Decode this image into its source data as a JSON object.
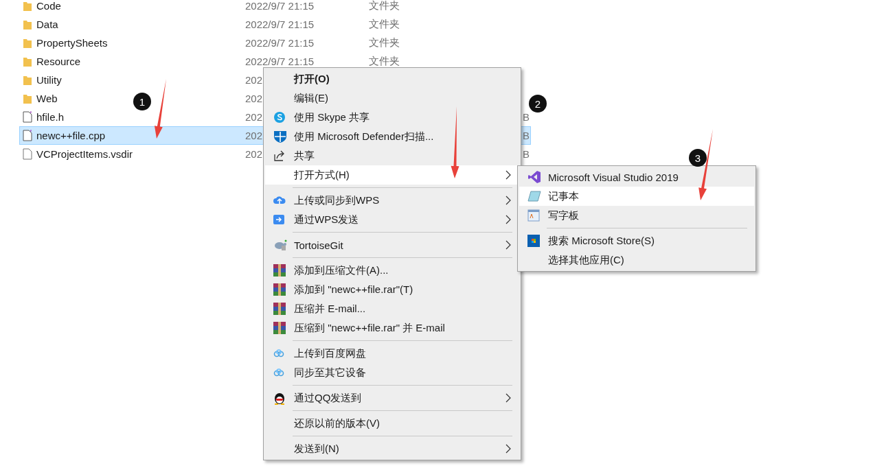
{
  "files": [
    {
      "name": "Code",
      "date": "2022/9/7 21:15",
      "type": "文件夹",
      "kind": "folder",
      "selected": false
    },
    {
      "name": "Data",
      "date": "2022/9/7 21:15",
      "type": "文件夹",
      "kind": "folder",
      "selected": false
    },
    {
      "name": "PropertySheets",
      "date": "2022/9/7 21:15",
      "type": "文件夹",
      "kind": "folder",
      "selected": false
    },
    {
      "name": "Resource",
      "date": "2022/9/7 21:15",
      "type": "文件夹",
      "kind": "folder",
      "selected": false
    },
    {
      "name": "Utility",
      "date": "202",
      "kind": "folder",
      "selected": false
    },
    {
      "name": "Web",
      "date": "202",
      "kind": "folder",
      "selected": false
    },
    {
      "name": "hfile.h",
      "date": "202",
      "size": "B",
      "kind": "code",
      "selected": false
    },
    {
      "name": "newc++file.cpp",
      "date": "202",
      "size": "B",
      "kind": "code",
      "selected": true
    },
    {
      "name": "VCProjectItems.vsdir",
      "date": "202",
      "size": "B",
      "kind": "file",
      "selected": false
    }
  ],
  "context_menu": {
    "sections": [
      [
        {
          "label": "打开(O)",
          "default": true,
          "selected": false,
          "submenu": false
        },
        {
          "label": "编辑(E)",
          "default": false,
          "selected": false,
          "submenu": false
        },
        {
          "label": "使用 Skype 共享",
          "default": false,
          "selected": false,
          "submenu": false
        },
        {
          "label": "使用 Microsoft Defender扫描...",
          "default": false,
          "selected": false,
          "submenu": false
        },
        {
          "label": "共享",
          "default": false,
          "selected": false,
          "submenu": false
        },
        {
          "label": "打开方式(H)",
          "default": false,
          "selected": true,
          "submenu": true
        }
      ],
      [
        {
          "label": "上传或同步到WPS",
          "default": false,
          "selected": false,
          "submenu": true
        },
        {
          "label": "通过WPS发送",
          "default": false,
          "selected": false,
          "submenu": true
        }
      ],
      [
        {
          "label": "TortoiseGit",
          "default": false,
          "selected": false,
          "submenu": true
        }
      ],
      [
        {
          "label": "添加到压缩文件(A)...",
          "default": false,
          "selected": false,
          "submenu": false
        },
        {
          "label": "添加到 \"newc++file.rar\"(T)",
          "default": false,
          "selected": false,
          "submenu": false
        },
        {
          "label": "压缩并 E-mail...",
          "default": false,
          "selected": false,
          "submenu": false
        },
        {
          "label": "压缩到 \"newc++file.rar\" 并 E-mail",
          "default": false,
          "selected": false,
          "submenu": false
        }
      ],
      [
        {
          "label": "上传到百度网盘",
          "default": false,
          "selected": false,
          "submenu": false
        },
        {
          "label": "同步至其它设备",
          "default": false,
          "selected": false,
          "submenu": false
        }
      ],
      [
        {
          "label": "通过QQ发送到",
          "default": false,
          "selected": false,
          "submenu": true
        }
      ],
      [
        {
          "label": "还原以前的版本(V)",
          "default": false,
          "selected": false,
          "submenu": false
        }
      ],
      [
        {
          "label": "发送到(N)",
          "default": false,
          "selected": false,
          "submenu": true
        }
      ]
    ]
  },
  "open_with_menu": {
    "sections": [
      [
        {
          "label": "Microsoft Visual Studio 2019",
          "default": false,
          "selected": false,
          "submenu": false
        },
        {
          "label": "记事本",
          "default": false,
          "selected": true,
          "submenu": false
        },
        {
          "label": "写字板",
          "default": false,
          "selected": false,
          "submenu": false
        }
      ],
      [
        {
          "label": "搜索 Microsoft Store(S)",
          "default": false,
          "selected": false,
          "submenu": false
        },
        {
          "label": "选择其他应用(C)",
          "default": false,
          "selected": false,
          "submenu": false
        }
      ]
    ]
  },
  "annotations": [
    {
      "label": "1"
    },
    {
      "label": "2"
    },
    {
      "label": "3"
    }
  ]
}
